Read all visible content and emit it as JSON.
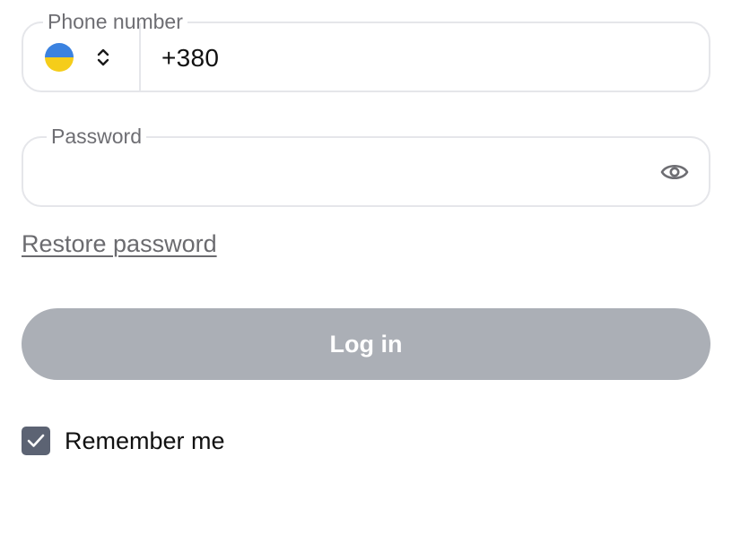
{
  "phone_field": {
    "label": "Phone number",
    "value": "+380",
    "country": {
      "icon": "ukraine-flag-icon",
      "flag_colors": [
        "#3b82e0",
        "#f5cd1a"
      ],
      "selector_icon": "chevron-up-down-icon"
    }
  },
  "password_field": {
    "label": "Password",
    "value": "",
    "toggle_icon": "eye-icon"
  },
  "restore_link": {
    "label": "Restore password"
  },
  "login_button": {
    "label": "Log in",
    "state": "disabled",
    "color": "#abafb6"
  },
  "remember_me": {
    "label": "Remember me",
    "checked": true,
    "check_color": "#5c6373"
  }
}
